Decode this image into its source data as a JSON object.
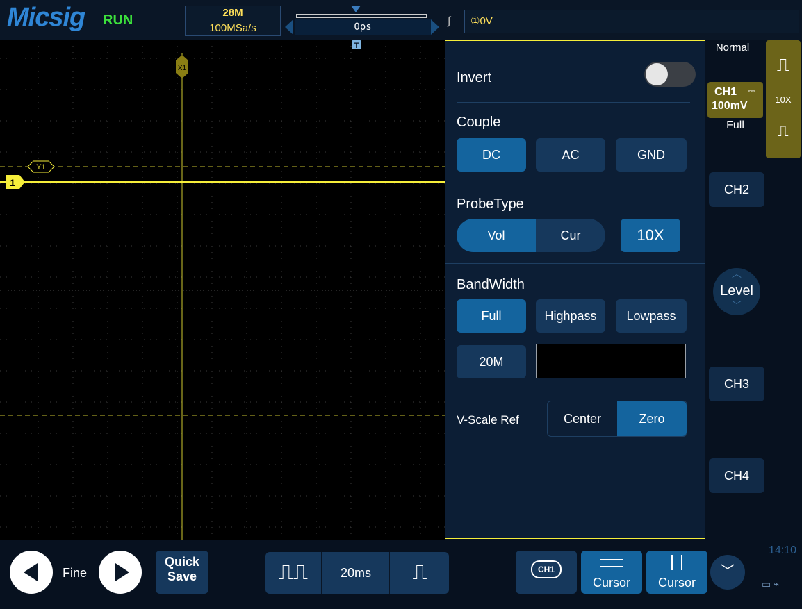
{
  "topbar": {
    "logo": "Micsig",
    "run_state": "RUN",
    "memory_depth": "28M",
    "sample_rate": "100MSa/s",
    "trigger_position": "0ps",
    "trigger_level": "①0V",
    "slope_icon": "rising-edge-icon"
  },
  "scope": {
    "channel_marker": "1",
    "cursor_x_label": "X1",
    "cursor_y_label": "Y1",
    "trigger_marker": "T",
    "trace_color": "#f6ee3a"
  },
  "panel": {
    "invert_label": "Invert",
    "invert_on": false,
    "couple_label": "Couple",
    "couple_options": [
      "DC",
      "AC",
      "GND"
    ],
    "couple_selected": "DC",
    "probe_label": "ProbeType",
    "probe_options": [
      "Vol",
      "Cur"
    ],
    "probe_selected": "Vol",
    "probe_ratio": "10X",
    "bandwidth_label": "BandWidth",
    "bandwidth_options": [
      "Full",
      "Highpass",
      "Lowpass"
    ],
    "bandwidth_selected": "Full",
    "bandwidth_20m": "20M",
    "bandwidth_value": "",
    "vscale_label": "V-Scale Ref",
    "vscale_options": [
      "Center",
      "Zero"
    ],
    "vscale_selected": "Zero"
  },
  "right": {
    "acq_mode": "Normal",
    "ch1_name": "CH1",
    "ch1_scale": "100mV",
    "ch1_bw": "Full",
    "probe_ratio": "10X",
    "ch2": "CH2",
    "ch3": "CH3",
    "ch4": "CH4",
    "level": "Level"
  },
  "bottom": {
    "fine": "Fine",
    "quick_save_1": "Quick",
    "quick_save_2": "Save",
    "timebase": "20ms",
    "ch_select": "CH1",
    "cursor_h": "Cursor",
    "cursor_v": "Cursor",
    "clock": "14:10"
  },
  "colors": {
    "accent": "#14649e",
    "channel1": "#f6ee3a",
    "run": "#3ce03c"
  }
}
